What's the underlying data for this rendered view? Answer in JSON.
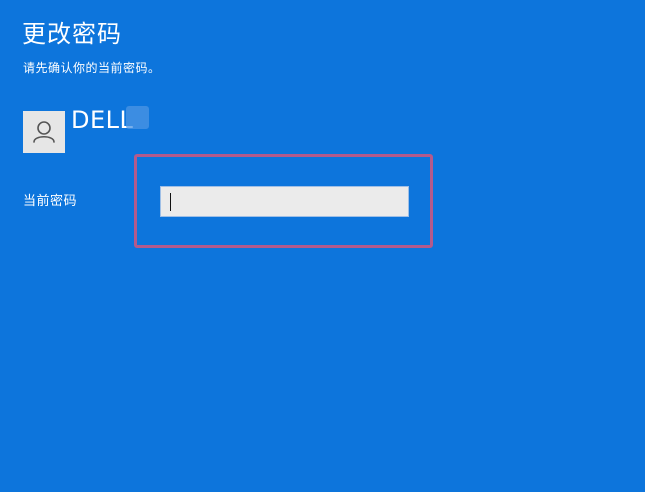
{
  "page": {
    "title": "更改密码",
    "subtitle": "请先确认你的当前密码。"
  },
  "account": {
    "name": "DELL",
    "avatar_icon": "user-icon"
  },
  "form": {
    "current_password_label": "当前密码",
    "current_password_value": "",
    "current_password_placeholder": ""
  },
  "colors": {
    "background": "#0d75dc",
    "highlight": "#b45a8c",
    "input_background": "#ebebeb"
  }
}
